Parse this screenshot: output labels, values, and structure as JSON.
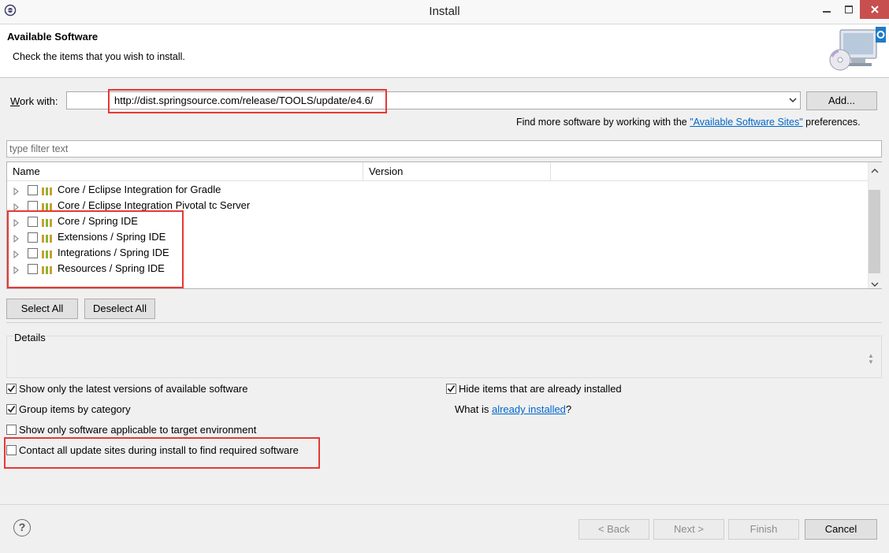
{
  "window": {
    "title": "Install"
  },
  "header": {
    "title": "Available Software",
    "subtitle": "Check the items that you wish to install."
  },
  "work_with": {
    "label": "Work with:",
    "value": "http://dist.springsource.com/release/TOOLS/update/e4.6/",
    "add_label": "Add..."
  },
  "find_more": {
    "prefix": "Find more software by working with the ",
    "link": "\"Available Software Sites\"",
    "suffix": " preferences."
  },
  "filter": {
    "placeholder": "type filter text"
  },
  "tree": {
    "columns": [
      "Name",
      "Version"
    ],
    "items": [
      {
        "label": "Core / Eclipse Integration for Gradle",
        "checked": false
      },
      {
        "label": "Core / Eclipse Integration Pivotal tc Server",
        "checked": false
      },
      {
        "label": "Core / Spring IDE",
        "checked": false
      },
      {
        "label": "Extensions / Spring IDE",
        "checked": false
      },
      {
        "label": "Integrations / Spring IDE",
        "checked": false
      },
      {
        "label": "Resources / Spring IDE",
        "checked": false
      }
    ]
  },
  "buttons": {
    "select_all": "Select All",
    "deselect_all": "Deselect All"
  },
  "details": {
    "label": "Details"
  },
  "options": {
    "latest_versions": {
      "label": "Show only the latest versions of available software",
      "checked": true
    },
    "group_by_category": {
      "label": "Group items by category",
      "checked": true
    },
    "target_env": {
      "label": "Show only software applicable to target environment",
      "checked": false
    },
    "contact_sites": {
      "label": "Contact all update sites during install to find required software",
      "checked": false
    },
    "hide_installed": {
      "label": "Hide items that are already installed",
      "checked": true
    }
  },
  "what_is": {
    "prefix": "What is ",
    "link": "already installed",
    "suffix": "?"
  },
  "footer": {
    "help": "?",
    "back": "< Back",
    "next": "Next >",
    "finish": "Finish",
    "cancel": "Cancel"
  },
  "colors": {
    "highlight": "#e53935",
    "link": "#0066cc",
    "close_button": "#c7504f"
  }
}
